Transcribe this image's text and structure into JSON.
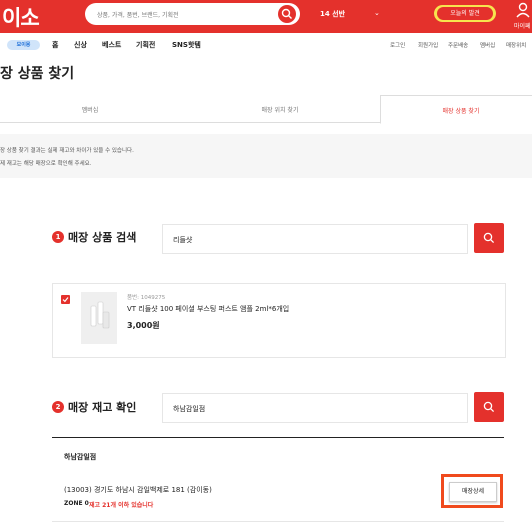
{
  "header": {
    "logo": "이소",
    "search_placeholder": "상품, 가격, 품번, 브랜드, 기획전",
    "store_name": "14  선반",
    "store_arrow": "⌄",
    "today_badge": "오늘의 발견",
    "mypage_label": "마이페"
  },
  "nav": {
    "badge": "모이몽",
    "items": [
      "홈",
      "신상",
      "베스트",
      "기획전",
      "SNS핫템"
    ],
    "util": [
      "로그인",
      "회원가입",
      "주문배송",
      "멤버십",
      "매장위치"
    ]
  },
  "page": {
    "title": "장 상품 찾기",
    "tabs": [
      "멤버십",
      "매장 위치 찾기",
      "매장 상품 찾기"
    ],
    "notice": [
      "장 상품 찾기 결과는 실제 재고와 차이가 있을 수 있습니다.",
      "제 재고는 해당 매장으로 확인해 주세요."
    ]
  },
  "section1": {
    "number": "1",
    "title": "매장 상품 검색",
    "input_value": "리들샷"
  },
  "product": {
    "code": "품번: 1049275",
    "name": "VT 리들샷 100 페이셜 부스팅 퍼스트 앰플 2ml*6개입",
    "price": "3,000원"
  },
  "section2": {
    "number": "2",
    "title": "매장 재고 확인",
    "input_value": "하남감일점"
  },
  "store_result": {
    "name": "하남감일점",
    "address": "(13003) 경기도 하남시 감일백제로 181 (감이동)",
    "zone": "ZONE 0",
    "stock": "재고 21개 이하 있습니다",
    "detail_button": "매장상세"
  },
  "colors": {
    "brand": "#e4312c",
    "highlight": "#f04a1d"
  }
}
